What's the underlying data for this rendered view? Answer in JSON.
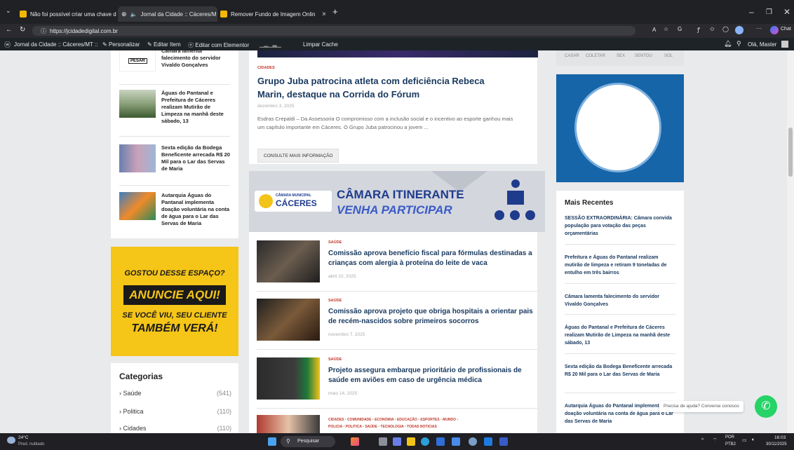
{
  "browser": {
    "tabs": [
      {
        "title": "Não foi possível criar uma chave d",
        "active": false,
        "color": "#f2b705"
      },
      {
        "title": "Jornal da Cidade :: Cáceres/M",
        "active": true,
        "color": "#8ab4f8"
      },
      {
        "title": "Remover Fundo de Imagem Onlin",
        "active": false,
        "color": "#f2b705"
      }
    ],
    "new_tab": "+",
    "url": "https://jcidadedigital.com.br",
    "chat_label": "Chat"
  },
  "admin_bar": {
    "site": "Jornal da Cidade :: Cáceres/MT ::",
    "customize": "Personalizar",
    "edit_item": "Editar Item",
    "edit_elementor": "Editar com Elementor",
    "clear_cache": "Limpar Cache",
    "greeting": "Olá, Master"
  },
  "sidebar_left": {
    "items": [
      {
        "title": "Câmara lamenta falecimento do servidor Vivaldo Gonçalves",
        "thumb_label": "PESAR"
      },
      {
        "title": "Águas do Pantanal e Prefeitura de Cáceres realizam Mutirão de Limpeza na manhã deste sábado, 13"
      },
      {
        "title": "Sexta edição da Bodega Beneficente arrecada R$ 20 Mil para o Lar das Servas de Maria"
      },
      {
        "title": "Autarquia Águas do Pantanal implementa doação voluntária na conta de água para o Lar das Servas de Maria"
      }
    ],
    "ad": {
      "line1": "GOSTOU DESSE ESPAÇO?",
      "line2": "ANUNCIE AQUI!",
      "line3": "SE VOCÊ VIU, SEU CLIENTE",
      "line4": "TAMBÉM VERÁ!"
    },
    "categories": {
      "title": "Categorias",
      "items": [
        {
          "name": "Saúde",
          "count": "(541)"
        },
        {
          "name": "Politica",
          "count": "(110)"
        },
        {
          "name": "Cidades",
          "count": "(110)"
        }
      ]
    }
  },
  "main": {
    "featured": {
      "category": "CIDADES",
      "title": "Grupo Juba patrocina atleta com deficiência Rebeca Marin, destaque na Corrida do Fórum",
      "date": "dezembro 3, 2025",
      "excerpt": "Esdras Crepaldi – Da Assessoria O compromisso com a inclusão social e o incentivo ao esporte ganhou mais um capítulo importante em Cáceres. O Grupo Juba patrocinou a jovem ...",
      "button": "CONSULTE MAIS INFORMAÇÃO"
    },
    "banner": {
      "logo_line1": "CÂMARA MUNICIPAL",
      "logo_line2": "CÁCERES",
      "title1": "CÂMARA ITINERANTE",
      "title2": "VENHA PARTICIPAR"
    },
    "news": [
      {
        "category": "SAÚDE",
        "title": "Comissão aprova benefício fiscal para fórmulas destinadas a crianças com alergia à proteína do leite de vaca",
        "date": "abril 10, 2025"
      },
      {
        "category": "SAÚDE",
        "title": "Comissão aprova projeto que obriga hospitais a orientar pais de recém-nascidos sobre primeiros socorros",
        "date": "novembro 7, 2025"
      },
      {
        "category": "SAÚDE",
        "title": "Projeto assegura embarque prioritário de profissionais de saúde em aviões em caso de urgência médica",
        "date": "maio 14, 2025"
      }
    ],
    "tags": [
      "CIDADES",
      "COMUNIDADE",
      "ECONOMIA",
      "EDUCAÇÃO",
      "ESPORTES",
      "MUNDO",
      "POLICIA",
      "POLITICA",
      "SAÚDE",
      "TECNOLOGIA",
      "TODAS NOTICIAS"
    ]
  },
  "sidebar_right": {
    "word_tags": [
      "CASAR",
      "COLETAR",
      "SEX",
      "SENTOU",
      "SOL"
    ],
    "recent_title": "Mais Recentes",
    "recent": [
      "SESSÃO EXTRAORDINÁRIA: Câmara convida população para votação das peças orçamentárias",
      "Prefeitura e Águas do Pantanal realizam mutirão de limpeza e retiram 9 toneladas de entulho em três bairros",
      "Câmara lamenta falecimento do servidor Vivaldo Gonçalves",
      "Águas do Pantanal e Prefeitura de Cáceres realizam Mutirão de Limpeza na manhã deste sábado, 13",
      "Sexta edição da Bodega Beneficente arrecada R$ 20 Mil para o Lar das Servas de Maria",
      "Autarquia Águas do Pantanal implementa doação voluntária na conta de água para o Lar das Servas de Maria"
    ]
  },
  "whatsapp": {
    "tooltip": "Precisa de ajuda? Converse conosco"
  },
  "taskbar": {
    "weather_temp": "24°C",
    "weather_desc": "Pred. nublado",
    "search": "Pesquisar",
    "lang": "POR",
    "lang2": "PTB2",
    "time": "16:03",
    "date": "30/11/2025"
  }
}
